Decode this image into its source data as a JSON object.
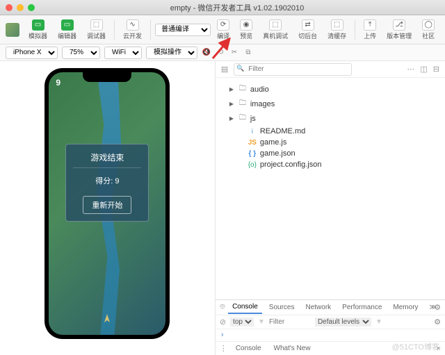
{
  "window": {
    "title": "empty - 微信开发者工具 v1.02.1902010"
  },
  "traffic": {
    "close": "#ff5f57",
    "min": "#febc2e",
    "max": "#28c840"
  },
  "toolbar": {
    "simulator": "模拟器",
    "editor": "编辑器",
    "debugger": "调试器",
    "cloud": "云开发",
    "compile_mode": "普通编译",
    "compile": "编译",
    "preview": "预览",
    "remote": "真机调试",
    "background": "切后台",
    "cache": "清缓存",
    "upload": "上传",
    "version": "版本管理",
    "community": "社区"
  },
  "subbar": {
    "device": "iPhone X",
    "zoom": "75%",
    "network": "WiFi",
    "sim_ops": "模拟操作"
  },
  "game": {
    "counter": "9",
    "over_title": "游戏结束",
    "score_label": "得分: 9",
    "restart": "重新开始"
  },
  "tree": {
    "folders": [
      {
        "name": "audio",
        "expanded": false
      },
      {
        "name": "images",
        "expanded": false
      },
      {
        "name": "js",
        "expanded": true
      }
    ],
    "files": [
      {
        "name": "README.md",
        "type": "md"
      },
      {
        "name": "game.js",
        "type": "js"
      },
      {
        "name": "game.json",
        "type": "json"
      },
      {
        "name": "project.config.json",
        "type": "cfg"
      }
    ]
  },
  "devtools": {
    "tabs": [
      "Console",
      "Sources",
      "Network",
      "Performance",
      "Memory"
    ],
    "active": "Console",
    "context": "top",
    "filter_ph": "Filter",
    "levels": "Default levels",
    "bottom_tabs": [
      "Console",
      "What's New"
    ]
  },
  "watermark": "@51CTO博客"
}
